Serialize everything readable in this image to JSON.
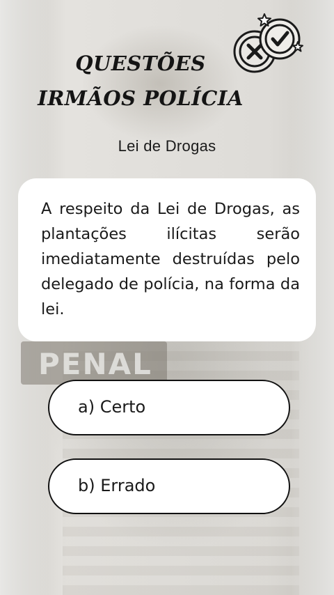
{
  "header": {
    "title_line1": "QUESTÕES",
    "title_line2": "IRMÃOS POLÍCIA",
    "logo_icon": "quiz-check-cross-icon"
  },
  "topic": "Lei de Drogas",
  "question": {
    "text": "A respeito da Lei de Drogas, as plantações ilícitas serão imediatamente  destruídas pelo delegado de polícia, na forma da lei."
  },
  "options": [
    {
      "label": "a) Certo"
    },
    {
      "label": "b) Errado"
    }
  ],
  "background": {
    "patch_text": "PENAL"
  },
  "colors": {
    "card": "#ffffff",
    "text": "#1a1a1a",
    "border": "#111111"
  }
}
